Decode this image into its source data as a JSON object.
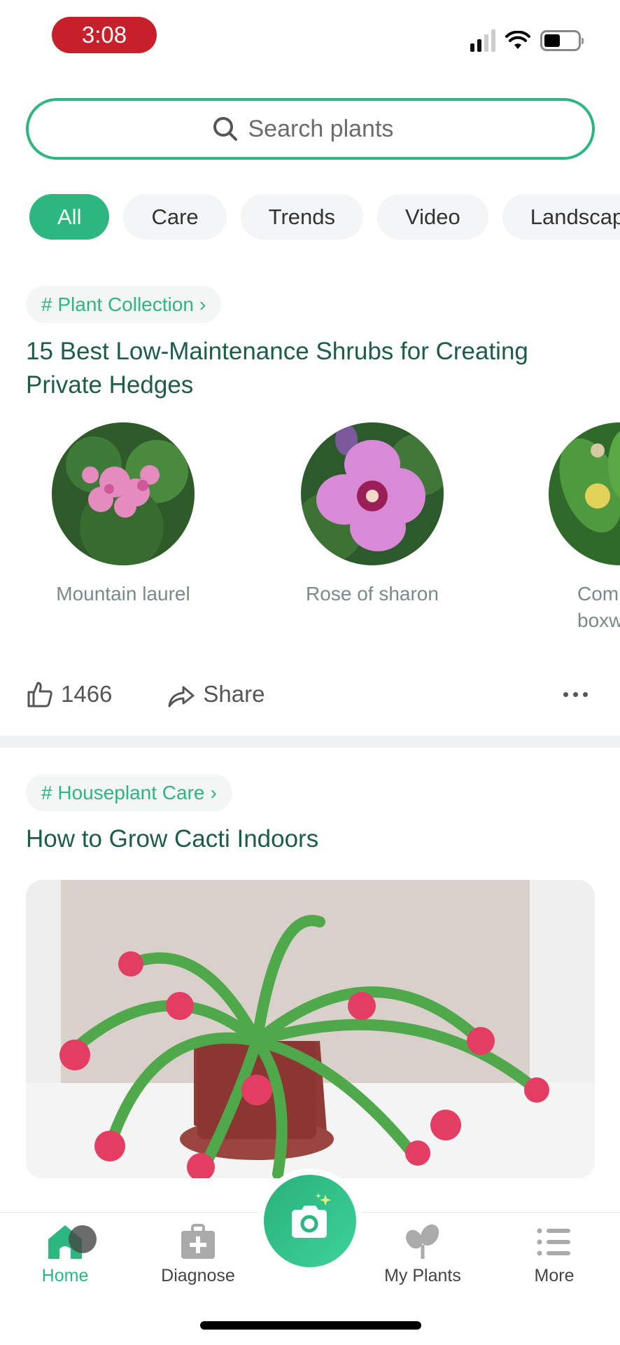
{
  "status_bar": {
    "time": "3:08",
    "signal_bars_on": 2,
    "battery_level": 0.48
  },
  "search": {
    "placeholder": "Search plants",
    "icon": "search-icon"
  },
  "chips": [
    {
      "label": "All",
      "active": true
    },
    {
      "label": "Care",
      "active": false
    },
    {
      "label": "Trends",
      "active": false
    },
    {
      "label": "Video",
      "active": false
    },
    {
      "label": "Landscaping",
      "active": false
    }
  ],
  "cards": [
    {
      "tag": "# Plant Collection",
      "title": "15 Best Low-Maintenance Shrubs for Creating Private Hedges",
      "plants": [
        {
          "name": "Mountain laurel"
        },
        {
          "name": "Rose of sharon"
        },
        {
          "name": "Common boxwood"
        }
      ],
      "likes": "1466",
      "share_label": "Share"
    },
    {
      "tag": "# Houseplant Care",
      "title": "How to Grow Cacti Indoors",
      "image_alt": "Christmas cactus in pot"
    }
  ],
  "tabbar": {
    "items": [
      {
        "label": "Home",
        "icon": "home-icon",
        "active": true
      },
      {
        "label": "Diagnose",
        "icon": "first-aid-kit-icon",
        "active": false
      },
      {
        "label": "",
        "icon": "camera-icon",
        "active": false
      },
      {
        "label": "My Plants",
        "icon": "sprout-icon",
        "active": false
      },
      {
        "label": "More",
        "icon": "list-icon",
        "active": false
      }
    ]
  },
  "colors": {
    "accent": "#2DB67F",
    "title": "#1B5E45",
    "time_pill": "#C8202B"
  }
}
